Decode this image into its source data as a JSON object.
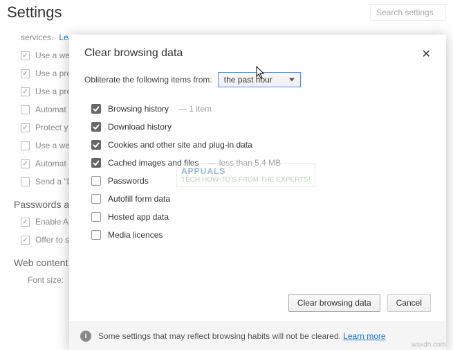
{
  "settings": {
    "title": "Settings",
    "search_placeholder": "Search settings",
    "services_link": "Learn more",
    "rows": [
      {
        "label": "Use a we",
        "checked": true
      },
      {
        "label": "Use a pre",
        "checked": true
      },
      {
        "label": "Use a pre",
        "checked": true
      },
      {
        "label": "Automat",
        "checked": false
      },
      {
        "label": "Protect y",
        "checked": true
      },
      {
        "label": "Use a we",
        "checked": false
      },
      {
        "label": "Automat",
        "checked": true
      },
      {
        "label": "Send a \"D",
        "checked": false
      }
    ],
    "section_passwords": "Passwords and",
    "pw_rows": [
      {
        "label": "Enable A",
        "checked": true
      },
      {
        "label": "Offer to s",
        "checked": true
      }
    ],
    "section_web": "Web content",
    "font_label": "Font size:"
  },
  "dialog": {
    "title": "Clear browsing data",
    "obliterate_label": "Obliterate the following items from:",
    "time_value": "the past hour",
    "items": [
      {
        "label": "Browsing history",
        "checked": true,
        "note": "—  1 item"
      },
      {
        "label": "Download history",
        "checked": true,
        "note": ""
      },
      {
        "label": "Cookies and other site and plug-in data",
        "checked": true,
        "note": ""
      },
      {
        "label": "Cached images and files",
        "checked": true,
        "note": "—  less than 5.4 MB"
      },
      {
        "label": "Passwords",
        "checked": false,
        "note": ""
      },
      {
        "label": "Autofill form data",
        "checked": false,
        "note": ""
      },
      {
        "label": "Hosted app data",
        "checked": false,
        "note": ""
      },
      {
        "label": "Media licences",
        "checked": false,
        "note": ""
      }
    ],
    "clear_button": "Clear browsing data",
    "cancel_button": "Cancel",
    "info_text": "Some settings that may reflect browsing habits will not be cleared.",
    "info_link": "Learn more"
  },
  "watermark": {
    "brand": "APPUALS",
    "tag": "TECH HOW-TO'S FROM THE EXPERTS!"
  },
  "footer": "wsxdn.com"
}
